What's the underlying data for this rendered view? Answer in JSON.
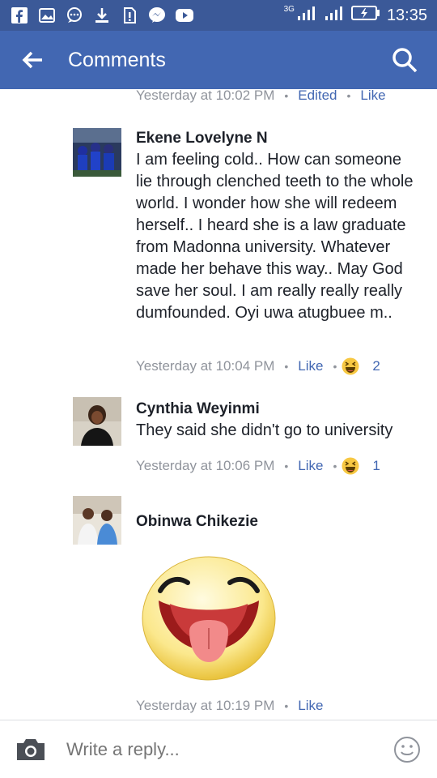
{
  "status": {
    "network": "3G",
    "time": "13:35"
  },
  "app_bar": {
    "title": "Comments"
  },
  "top_meta": {
    "time": "Yesterday at 10:02 PM",
    "edited": "Edited",
    "like": "Like"
  },
  "comments": [
    {
      "author": "Ekene Lovelyne N",
      "text": "I am feeling cold.. How can someone lie through clenched teeth to the whole world. I wonder how she will redeem herself.. I heard she is a law graduate from Madonna university. Whatever made her behave this way.. May God save her soul. I am really really really dumfounded. Oyi uwa atugbuee m..",
      "time": "Yesterday at 10:04 PM",
      "like": "Like",
      "reaction_count": "2"
    },
    {
      "author": "Cynthia Weyinmi",
      "text": "They said she didn't go to university",
      "time": "Yesterday at 10:06 PM",
      "like": "Like",
      "reaction_count": "1"
    },
    {
      "author": "Obinwa Chikezie",
      "text": "",
      "time": "Yesterday at 10:19 PM",
      "like": "Like"
    }
  ],
  "reply": {
    "placeholder": "Write a reply..."
  },
  "colors": {
    "brand": "#3b5998",
    "appbar": "#4267b2",
    "meta_gray": "#90949c"
  }
}
